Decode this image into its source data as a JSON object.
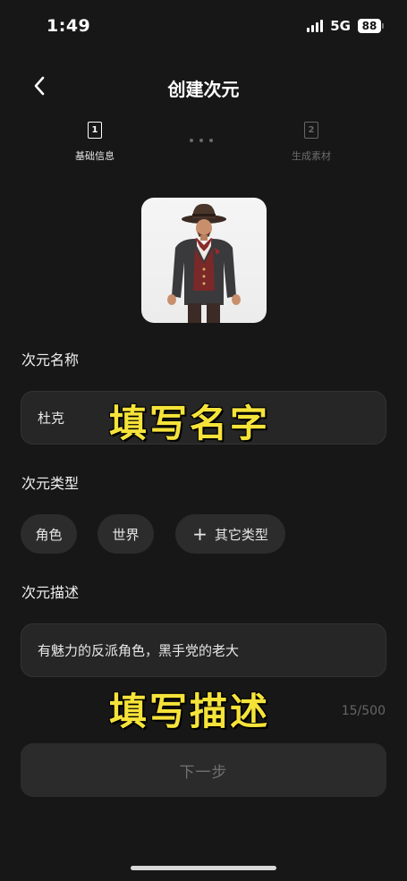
{
  "status_bar": {
    "time": "1:49",
    "network": "5G",
    "battery": "88"
  },
  "header": {
    "title": "创建次元"
  },
  "steps": [
    {
      "number": "1",
      "label": "基础信息"
    },
    {
      "number": "2",
      "label": "生成素材"
    }
  ],
  "form": {
    "name_label": "次元名称",
    "name_value": "杜克",
    "type_label": "次元类型",
    "type_options": [
      "角色",
      "世界",
      "其它类型"
    ],
    "description_label": "次元描述",
    "description_value": "有魅力的反派角色，黑手党的老大",
    "char_counter": "15/500"
  },
  "overlays": {
    "name_hint": "填写名字",
    "description_hint": "填写描述"
  },
  "next_button": "下一步",
  "colors": {
    "background": "#171717",
    "field": "#262626",
    "highlight": "#f6e33a"
  }
}
